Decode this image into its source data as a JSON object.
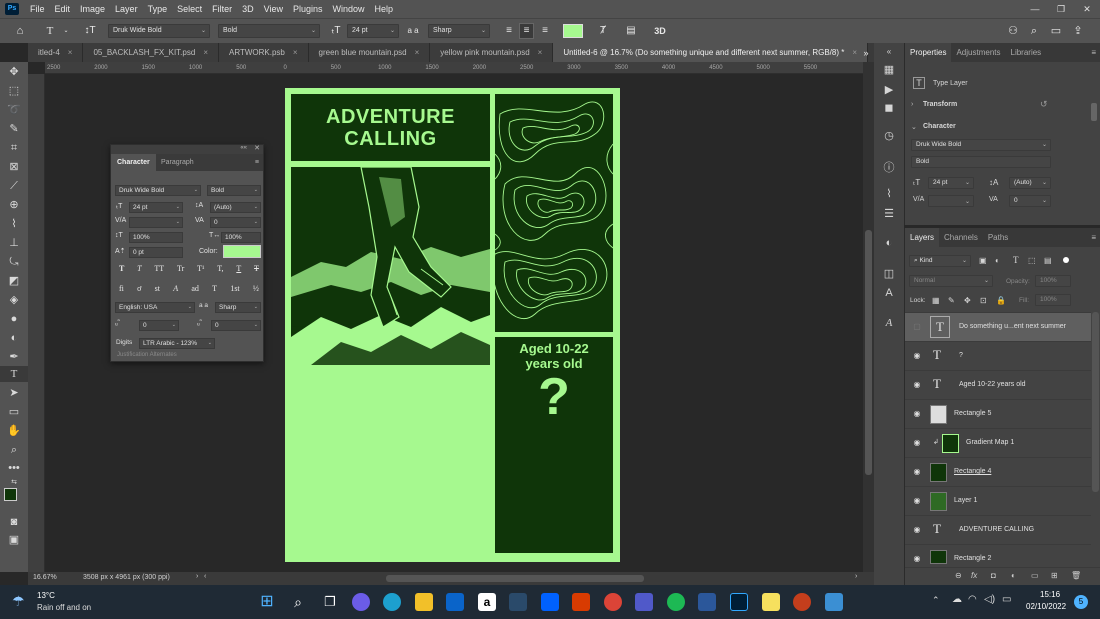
{
  "menu": {
    "items": [
      "File",
      "Edit",
      "Image",
      "Layer",
      "Type",
      "Select",
      "Filter",
      "3D",
      "View",
      "Plugins",
      "Window",
      "Help"
    ],
    "logo": "Ps"
  },
  "options": {
    "font_family": "Druk Wide Bold",
    "font_style": "Bold",
    "font_size": "24 pt",
    "aa_label": "a a",
    "antialias": "Sharp",
    "color": "#a6f98f",
    "mode_3d": "3D"
  },
  "tabs": [
    {
      "label": "itled-4"
    },
    {
      "label": "05_BACKLASH_FX_KIT.psd"
    },
    {
      "label": "ARTWORK.psb"
    },
    {
      "label": "green blue mountain.psd"
    },
    {
      "label": "yellow pink mountain.psd"
    },
    {
      "label": "Untitled-6 @ 16.7% (Do something  unique and  different next summer, RGB/8) *"
    }
  ],
  "ruler": {
    "top": [
      "2500",
      "2000",
      "1500",
      "1000",
      "500",
      "0",
      "500",
      "1000",
      "1500",
      "2000",
      "2500",
      "3000",
      "3500",
      "4000",
      "4500",
      "5000",
      "5500"
    ]
  },
  "status": {
    "zoom": "16.67%",
    "doc_size": "3508 px x 4961 px (300 ppi)"
  },
  "document": {
    "headline_1": "ADVENTURE",
    "headline_2": "CALLING",
    "aged_1": "Aged 10-22",
    "aged_2": "years old",
    "question": "?",
    "bg_color": "#a6f98f",
    "dark_color": "#0f3509"
  },
  "character_panel": {
    "tab_character": "Character",
    "tab_paragraph": "Paragraph",
    "font_family": "Druk Wide Bold",
    "font_style": "Bold",
    "font_size": "24 pt",
    "leading": "(Auto)",
    "tracking": "0",
    "vscale": "100%",
    "hscale": "100%",
    "baseline": "0 pt",
    "color_label": "Color:",
    "style_buttons": [
      "T",
      "T",
      "TT",
      "Tr",
      "T¹",
      "T,",
      "T",
      "T"
    ],
    "opentype_buttons": [
      "fi",
      "ơ",
      "st",
      "A",
      "ad",
      "T",
      "1st",
      "½"
    ],
    "language": "English: USA",
    "aa_label": "a a",
    "antialias": "Sharp",
    "val_left": "0",
    "val_right": "0",
    "digits_label": "Digits",
    "digits_value": "LTR Arabic - 123%",
    "justification": "Justification Alternates"
  },
  "properties_panel": {
    "tabs": [
      "Properties",
      "Adjustments",
      "Libraries"
    ],
    "type_layer": "Type Layer",
    "transform": "Transform",
    "character": "Character",
    "font_family": "Druk Wide Bold",
    "font_style": "Bold",
    "font_size": "24 pt",
    "leading": "(Auto)",
    "tracking": "0"
  },
  "layers_panel": {
    "tabs": [
      "Layers",
      "Channels",
      "Paths"
    ],
    "kind": "Kind",
    "blend": "Normal",
    "opacity_label": "Opacity:",
    "opacity": "100%",
    "lock_label": "Lock:",
    "fill_label": "Fill:",
    "fill": "100%",
    "layers": [
      {
        "name": "Do something  u...ent next summer",
        "type": "text",
        "visible": false,
        "selected": true
      },
      {
        "name": "?",
        "type": "text",
        "visible": true
      },
      {
        "name": "Aged 10-22  years old",
        "type": "text",
        "visible": true
      },
      {
        "name": "Rectangle 5",
        "type": "shape",
        "visible": true
      },
      {
        "name": "Gradient Map 1",
        "type": "adjustment",
        "visible": true
      },
      {
        "name": "Rectangle 4",
        "type": "shape",
        "visible": true
      },
      {
        "name": "Layer 1",
        "type": "pixel",
        "visible": true
      },
      {
        "name": "ADVENTURE CALLING",
        "type": "text",
        "visible": true
      },
      {
        "name": "Rectangle 2",
        "type": "shape",
        "visible": true
      }
    ]
  },
  "taskbar": {
    "weather_temp": "13°C",
    "weather_text": "Rain off and on",
    "time": "15:16",
    "date": "02/10/2022",
    "badge": "5"
  }
}
